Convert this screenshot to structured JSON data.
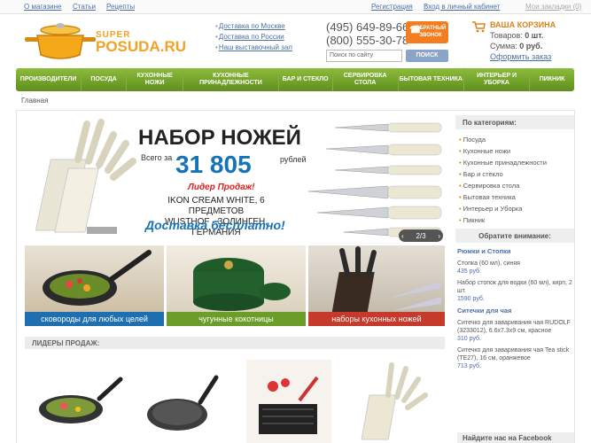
{
  "topbar": {
    "about": "О магазине",
    "articles": "Статьи",
    "recipes": "Рецепты",
    "register": "Регистрация",
    "login": "Вход в личный кабинет",
    "bookmarks": "Мои закладки (0)"
  },
  "logo": {
    "super": "SUPER",
    "name": "POSUDA.RU"
  },
  "delivery": [
    "Доставка по Москве",
    "Доставка по России",
    "Наш выставочный зал"
  ],
  "phones": [
    "(495) 649-89-66",
    "(800) 555-30-78"
  ],
  "callback": {
    "line1": "ОБРАТНЫЙ",
    "line2": "ЗВОНОК"
  },
  "search": {
    "placeholder": "Поиск по сайту",
    "button": "ПОИСК"
  },
  "cart": {
    "title": "ВАША КОРЗИНА",
    "items_label": "Товаров:",
    "items": "0 шт.",
    "sum_label": "Сумма:",
    "sum": "0 руб.",
    "checkout": "Оформить заказ"
  },
  "nav": [
    "ПРОИЗВОДИТЕЛИ",
    "ПОСУДА",
    "КУХОННЫЕ НОЖИ",
    "КУХОННЫЕ ПРИНАДЛЕЖНОСТИ",
    "БАР И СТЕКЛО",
    "СЕРВИРОВКА СТОЛА",
    "БЫТОВАЯ ТЕХНИКА",
    "ИНТЕРЬЕР И УБОРКА",
    "ПИКНИК"
  ],
  "breadcrumb": "Главная",
  "banner": {
    "title": "НАБОР НОЖЕЙ",
    "price_prefix": "Всего за",
    "price": "31 805",
    "price_suffix": "рублей",
    "hit": "Лидер Продаж!",
    "line1": "IKON CREAM WHITE, 6 ПРЕДМЕТОВ",
    "line2": "WUSTHOF - ЗОЛИНГЕН, ГЕРМАНИЯ",
    "delivery": "Доставка бесплатно!",
    "pager": "2/3"
  },
  "tiles": [
    "сковороды для любых целей",
    "чугунные кокотницы",
    "наборы кухонных ножей"
  ],
  "leaders": "ЛИДЕРЫ ПРОДАЖ:",
  "sidebar": {
    "cat_title": "По категориям:",
    "categories": [
      "Посуда",
      "Кухонные ножи",
      "Кухонные принадлежности",
      "Бар и стекло",
      "Сервировка стола",
      "Бытовая техника",
      "Интерьер и Уборка",
      "Пикник"
    ],
    "attention_title": "Обратите внимание:",
    "groups": [
      {
        "heading": "Рюмки и Стопки",
        "items": [
          {
            "desc": "Стопка (60 мл), синяя",
            "price": "435 руб."
          },
          {
            "desc": "Набор стопок для водки (60 мл), кирп, 2 шт.",
            "price": "1590 руб."
          }
        ]
      },
      {
        "heading": "Ситечки для чая",
        "items": [
          {
            "desc": "Ситечко для заваривания чая RUDOLF (3233012), 6.6x7.3x9 см, красное",
            "price": "310 руб."
          },
          {
            "desc": "Ситечко для заваривания чая Tea stick (TE27), 16 см, оранжевое",
            "price": "713 руб."
          }
        ]
      }
    ],
    "facebook": "Найдите нас на Facebook"
  },
  "colors": {
    "accent": "#f47d20",
    "nav": "#6e9f28",
    "link": "#4c6fa3",
    "banner_blue": "#1673b8"
  }
}
